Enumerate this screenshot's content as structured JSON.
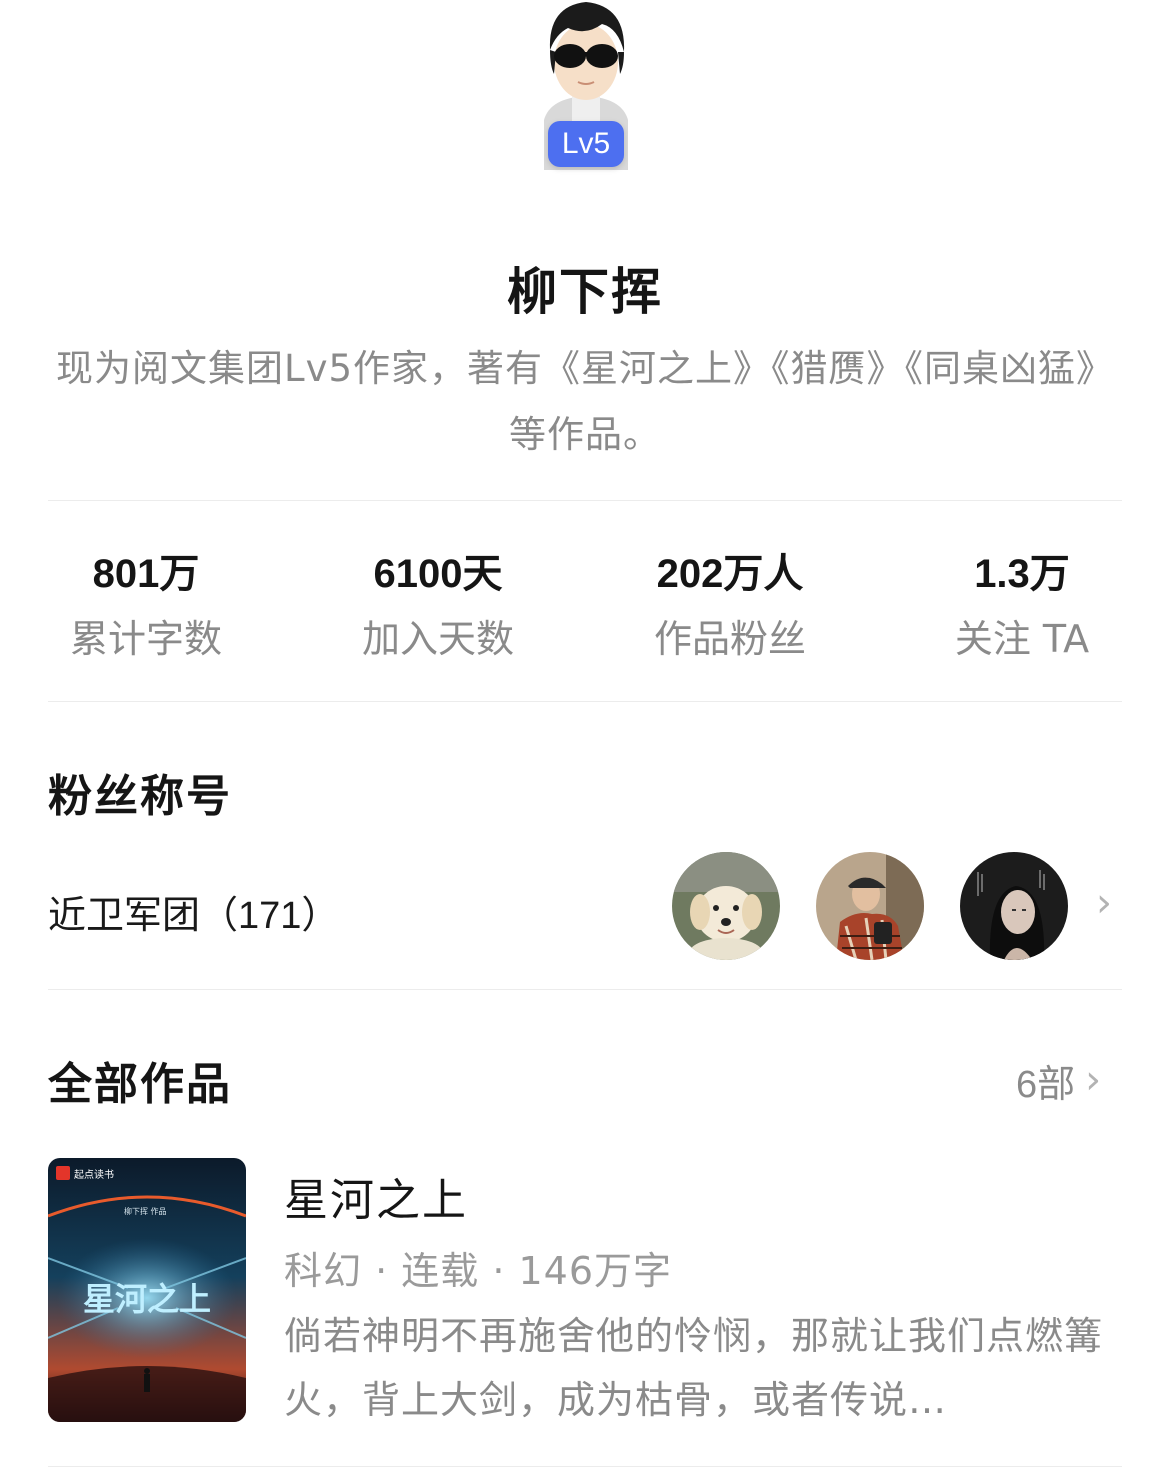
{
  "author": {
    "level_badge": "Lv5",
    "name": "柳下挥",
    "bio": "现为阅文集团Lv5作家，著有《星河之上》《猎赝》《同桌凶猛》等作品。"
  },
  "stats": [
    {
      "value": "801万",
      "label": "累计字数"
    },
    {
      "value": "6100天",
      "label": "加入天数"
    },
    {
      "value": "202万人",
      "label": "作品粉丝"
    },
    {
      "value": "1.3万",
      "label": "关注 TA"
    }
  ],
  "fan_section": {
    "title": "粉丝称号",
    "fan_group": "近卫军团（171）",
    "avatar_icons": [
      "dog-avatar",
      "cap-person-avatar",
      "woman-portrait-avatar"
    ],
    "chevron": "›"
  },
  "works_section": {
    "title": "全部作品",
    "count": "6部",
    "chevron": "›"
  },
  "books": [
    {
      "cover_brand": "起点读书",
      "cover_author": "柳下挥 作品",
      "cover_title": "星河之上",
      "title": "星河之上",
      "meta": "科幻 · 连载 · 146万字",
      "description": "倘若神明不再施舍他的怜悯，那就让我们点燃篝火，背上大剑，成为枯骨，或者传说…"
    }
  ],
  "colors": {
    "level_badge": "#4d6ff0",
    "text_primary": "#151515",
    "text_secondary": "#8a8a8a",
    "divider": "#ececec"
  }
}
